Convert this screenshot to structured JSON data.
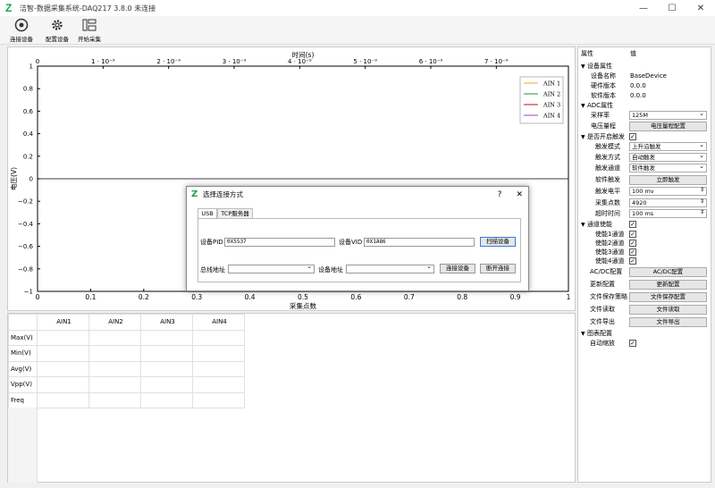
{
  "window": {
    "title": "洁智-数据采集系统-DAQ217 3.8.0 未连接",
    "controls": [
      "—",
      "☐",
      "✕"
    ]
  },
  "toolbar": {
    "connect_label": "连接设备",
    "configure_label": "配置设备",
    "start_label": "开始采集"
  },
  "chart_data": {
    "type": "line",
    "title": "",
    "x_top_label": "时间(s)",
    "x_top_ticks": [
      "0",
      "1 · 10⁻⁹",
      "2 · 10⁻⁹",
      "3 · 10⁻⁹",
      "4 · 10⁻⁹",
      "5 · 10⁻⁹",
      "6 · 10⁻⁹",
      "7 · 10⁻⁹"
    ],
    "xlabel": "采集点数",
    "x_ticks": [
      "0",
      "0.1",
      "0.2",
      "0.3",
      "0.4",
      "0.5",
      "0.6",
      "0.7",
      "0.8",
      "0.9",
      "1"
    ],
    "xlim": [
      0,
      1
    ],
    "ylabel": "电压(V)",
    "y_ticks": [
      "1",
      "0.8",
      "0.6",
      "0.4",
      "0.2",
      "0",
      "−0.2",
      "−0.4",
      "−0.6",
      "−0.8",
      "−1"
    ],
    "ylim": [
      -1,
      1
    ],
    "legend_position": "top-right",
    "series": [
      {
        "name": "AIN 1",
        "color": "#f5a623",
        "values": []
      },
      {
        "name": "AIN 2",
        "color": "#2e8b3a",
        "values": []
      },
      {
        "name": "AIN 3",
        "color": "#d0021b",
        "values": []
      },
      {
        "name": "AIN 4",
        "color": "#9b3fc6",
        "values": []
      }
    ]
  },
  "stats": {
    "columns": [
      "AIN1",
      "AIN2",
      "AIN3",
      "AIN4"
    ],
    "rows": [
      "Max(V)",
      "Min(V)",
      "Avg(V)",
      "Vpp(V)",
      "Freq"
    ]
  },
  "props": {
    "header_name": "属性",
    "header_value": "值",
    "device_group": "设备属性",
    "device_name_k": "设备名称",
    "device_name_v": "BaseDevice",
    "hw_ver_k": "硬件版本",
    "hw_ver_v": "0.0.0",
    "sw_ver_k": "软件版本",
    "sw_ver_v": "0.0.0",
    "adc_group": "ADC属性",
    "sample_rate_k": "采样率",
    "sample_rate_v": "125M",
    "volt_range_k": "电压量程",
    "volt_range_btn": "电压量程配置",
    "trigger_group": "是否开启触发",
    "trig_mode_k": "触发模式",
    "trig_mode_v": "上升沿触发",
    "trig_way_k": "触发方式",
    "trig_way_v": "自动触发",
    "trig_ch_k": "触发通道",
    "trig_ch_v": "软件触发",
    "soft_trig_k": "软件触发",
    "soft_trig_btn": "立即触发",
    "trig_level_k": "触发电平",
    "trig_level_v": "100 mv",
    "points_k": "采集点数",
    "points_v": "4920",
    "timeout_k": "超时时间",
    "timeout_v": "100 ms",
    "ch_enable_group": "通道使能",
    "en1_k": "使能1通道",
    "en2_k": "使能2通道",
    "en3_k": "使能3通道",
    "en4_k": "使能4通道",
    "acdc_k": "AC/DC配置",
    "acdc_btn": "AC/DC配置",
    "update_k": "更新配置",
    "update_btn": "更新配置",
    "save_k": "文件保存策略",
    "save_btn": "文件保存配置",
    "read_k": "文件读取",
    "read_btn": "文件读取",
    "export_k": "文件导出",
    "export_btn": "文件导出",
    "chart_group": "图表配置",
    "autoscale_k": "自动缩放",
    "check": "✓"
  },
  "dialog": {
    "title": "选择连接方式",
    "help": "?",
    "close": "✕",
    "tab_usb": "USB",
    "tab_tcp": "TCP服务器",
    "pid_label": "设备PID",
    "pid_value": "0X5537",
    "vid_label": "设备VID",
    "vid_value": "0X1A86",
    "scan_btn": "扫描设备",
    "bus_label": "总线地址",
    "dev_addr_label": "设备地址",
    "connect_btn": "连接设备",
    "disconnect_btn": "断开连接"
  }
}
